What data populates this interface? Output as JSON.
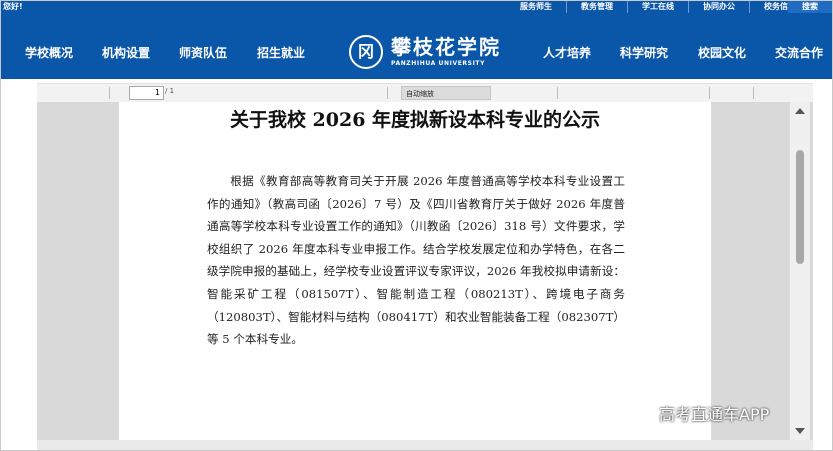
{
  "topbar": {
    "greeting": "您好!",
    "links": [
      "服务师生",
      "教务管理",
      "学工在线",
      "协同办公",
      "校务信箱"
    ],
    "search_label": "搜索"
  },
  "nav": {
    "left": [
      "学校概况",
      "机构设置",
      "师资队伍",
      "招生就业"
    ],
    "right": [
      "人才培养",
      "科学研究",
      "校园文化",
      "交流合作"
    ]
  },
  "logo": {
    "seal": "冈",
    "name_cn": "攀枝花学院",
    "name_en": "PANZHIHUA UNIVERSITY"
  },
  "pdf_toolbar": {
    "page_number": "1",
    "page_total": "/ 1",
    "zoom": "自动缩放"
  },
  "document": {
    "title": "关于我校 2026 年度拟新设本科专业的公示",
    "paragraph": "根据《教育部高等教育司关于开展 2026 年度普通高等学校本科专业设置工作的通知》（教高司函〔2026〕7 号）及《四川省教育厅关于做好 2026 年度普通高等学校本科专业设置工作的通知》（川教函〔2026〕318 号）文件要求，学校组织了 2026 年度本科专业申报工作。结合学校发展定位和办学特色，在各二级学院申报的基础上，经学校专业设置评议专家评议，2026 年我校拟申请新设：智能采矿工程（081507T）、智能制造工程（080213T）、跨境电子商务（120803T）、智能材料与结构（080417T）和农业智能装备工程（082307T）等 5 个本科专业。"
  },
  "watermark": "高考直通车APP"
}
